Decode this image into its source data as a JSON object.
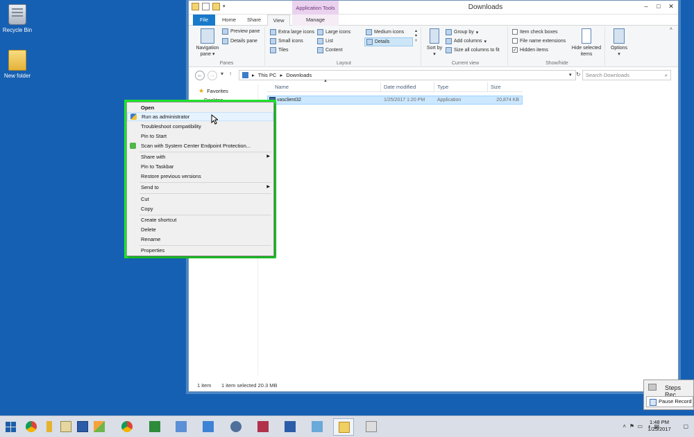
{
  "desktop": {
    "icons": [
      {
        "label": "Recycle Bin"
      },
      {
        "label": "New folder"
      }
    ]
  },
  "window": {
    "title": "Downloads",
    "contextual_tab_group": "Application Tools",
    "tabs": {
      "file": "File",
      "home": "Home",
      "share": "Share",
      "view": "View",
      "manage": "Manage"
    },
    "controls": {
      "minimize": "–",
      "maximize": "□",
      "close": "✕"
    },
    "ribbon": {
      "panes": {
        "label": "Panes",
        "navigation_pane": "Navigation pane",
        "preview_pane": "Preview pane",
        "details_pane": "Details pane"
      },
      "layout": {
        "label": "Layout",
        "items": [
          "Extra large icons",
          "Large icons",
          "Medium icons",
          "Small icons",
          "List",
          "Details",
          "Tiles",
          "Content"
        ],
        "selected": "Details"
      },
      "current_view": {
        "label": "Current view",
        "sort_by": "Sort by",
        "group_by": "Group by",
        "add_columns": "Add columns",
        "size_all_columns": "Size all columns to fit"
      },
      "show_hide": {
        "label": "Show/hide",
        "item_check_boxes": {
          "label": "Item check boxes",
          "checked": false
        },
        "file_name_extensions": {
          "label": "File name extensions",
          "checked": false
        },
        "hidden_items": {
          "label": "Hidden items",
          "checked": true
        },
        "hide_selected_items": "Hide selected items"
      },
      "options": "Options"
    },
    "address": {
      "path": [
        "This PC",
        "Downloads"
      ],
      "search_placeholder": "Search Downloads"
    },
    "nav_pane": {
      "favorites": "Favorites",
      "desktop": "Desktop"
    },
    "columns": [
      "Name",
      "Date modified",
      "Type",
      "Size"
    ],
    "files": [
      {
        "name": "vasclient32",
        "date": "1/25/2017 1:20 PM",
        "type": "Application",
        "size": "20,874 KB"
      }
    ],
    "status": {
      "count": "1 item",
      "selected": "1 item selected  20.3 MB"
    }
  },
  "context_menu": {
    "items": [
      {
        "label": "Open",
        "bold": true
      },
      {
        "label": "Run as administrator",
        "hover": true,
        "icon": "shield-icon"
      },
      {
        "label": "Troubleshoot compatibility"
      },
      {
        "label": "Pin to Start"
      },
      {
        "label": "Scan with System Center Endpoint Protection...",
        "icon": "endpoint-protection-icon"
      },
      {
        "label": "Share with",
        "submenu": true
      },
      {
        "label": "Pin to Taskbar"
      },
      {
        "label": "Restore previous versions"
      },
      {
        "label": "Send to",
        "submenu": true
      },
      {
        "label": "Cut"
      },
      {
        "label": "Copy"
      },
      {
        "label": "Create shortcut"
      },
      {
        "label": "Delete"
      },
      {
        "label": "Rename"
      },
      {
        "label": "Properties"
      }
    ],
    "highlight_color": "#1ee52b"
  },
  "steps_recorder": {
    "title": "Steps Rec",
    "pause_button": "Pause Record"
  },
  "taskbar": {
    "clock_time": "1:48 PM",
    "clock_date": "1/25/2017",
    "apps": [
      "windows-start-icon",
      "chrome-icon",
      "keys-icon",
      "notepad-icon",
      "remote-desktop-icon",
      "pencil-icon",
      "chrome-icon",
      "grid-app-icon",
      "doc-app-icon",
      "media-player-icon",
      "elephant-icon",
      "access-icon",
      "powershell-icon",
      "tools-icon",
      "file-explorer-icon",
      "steps-recorder-icon"
    ]
  }
}
